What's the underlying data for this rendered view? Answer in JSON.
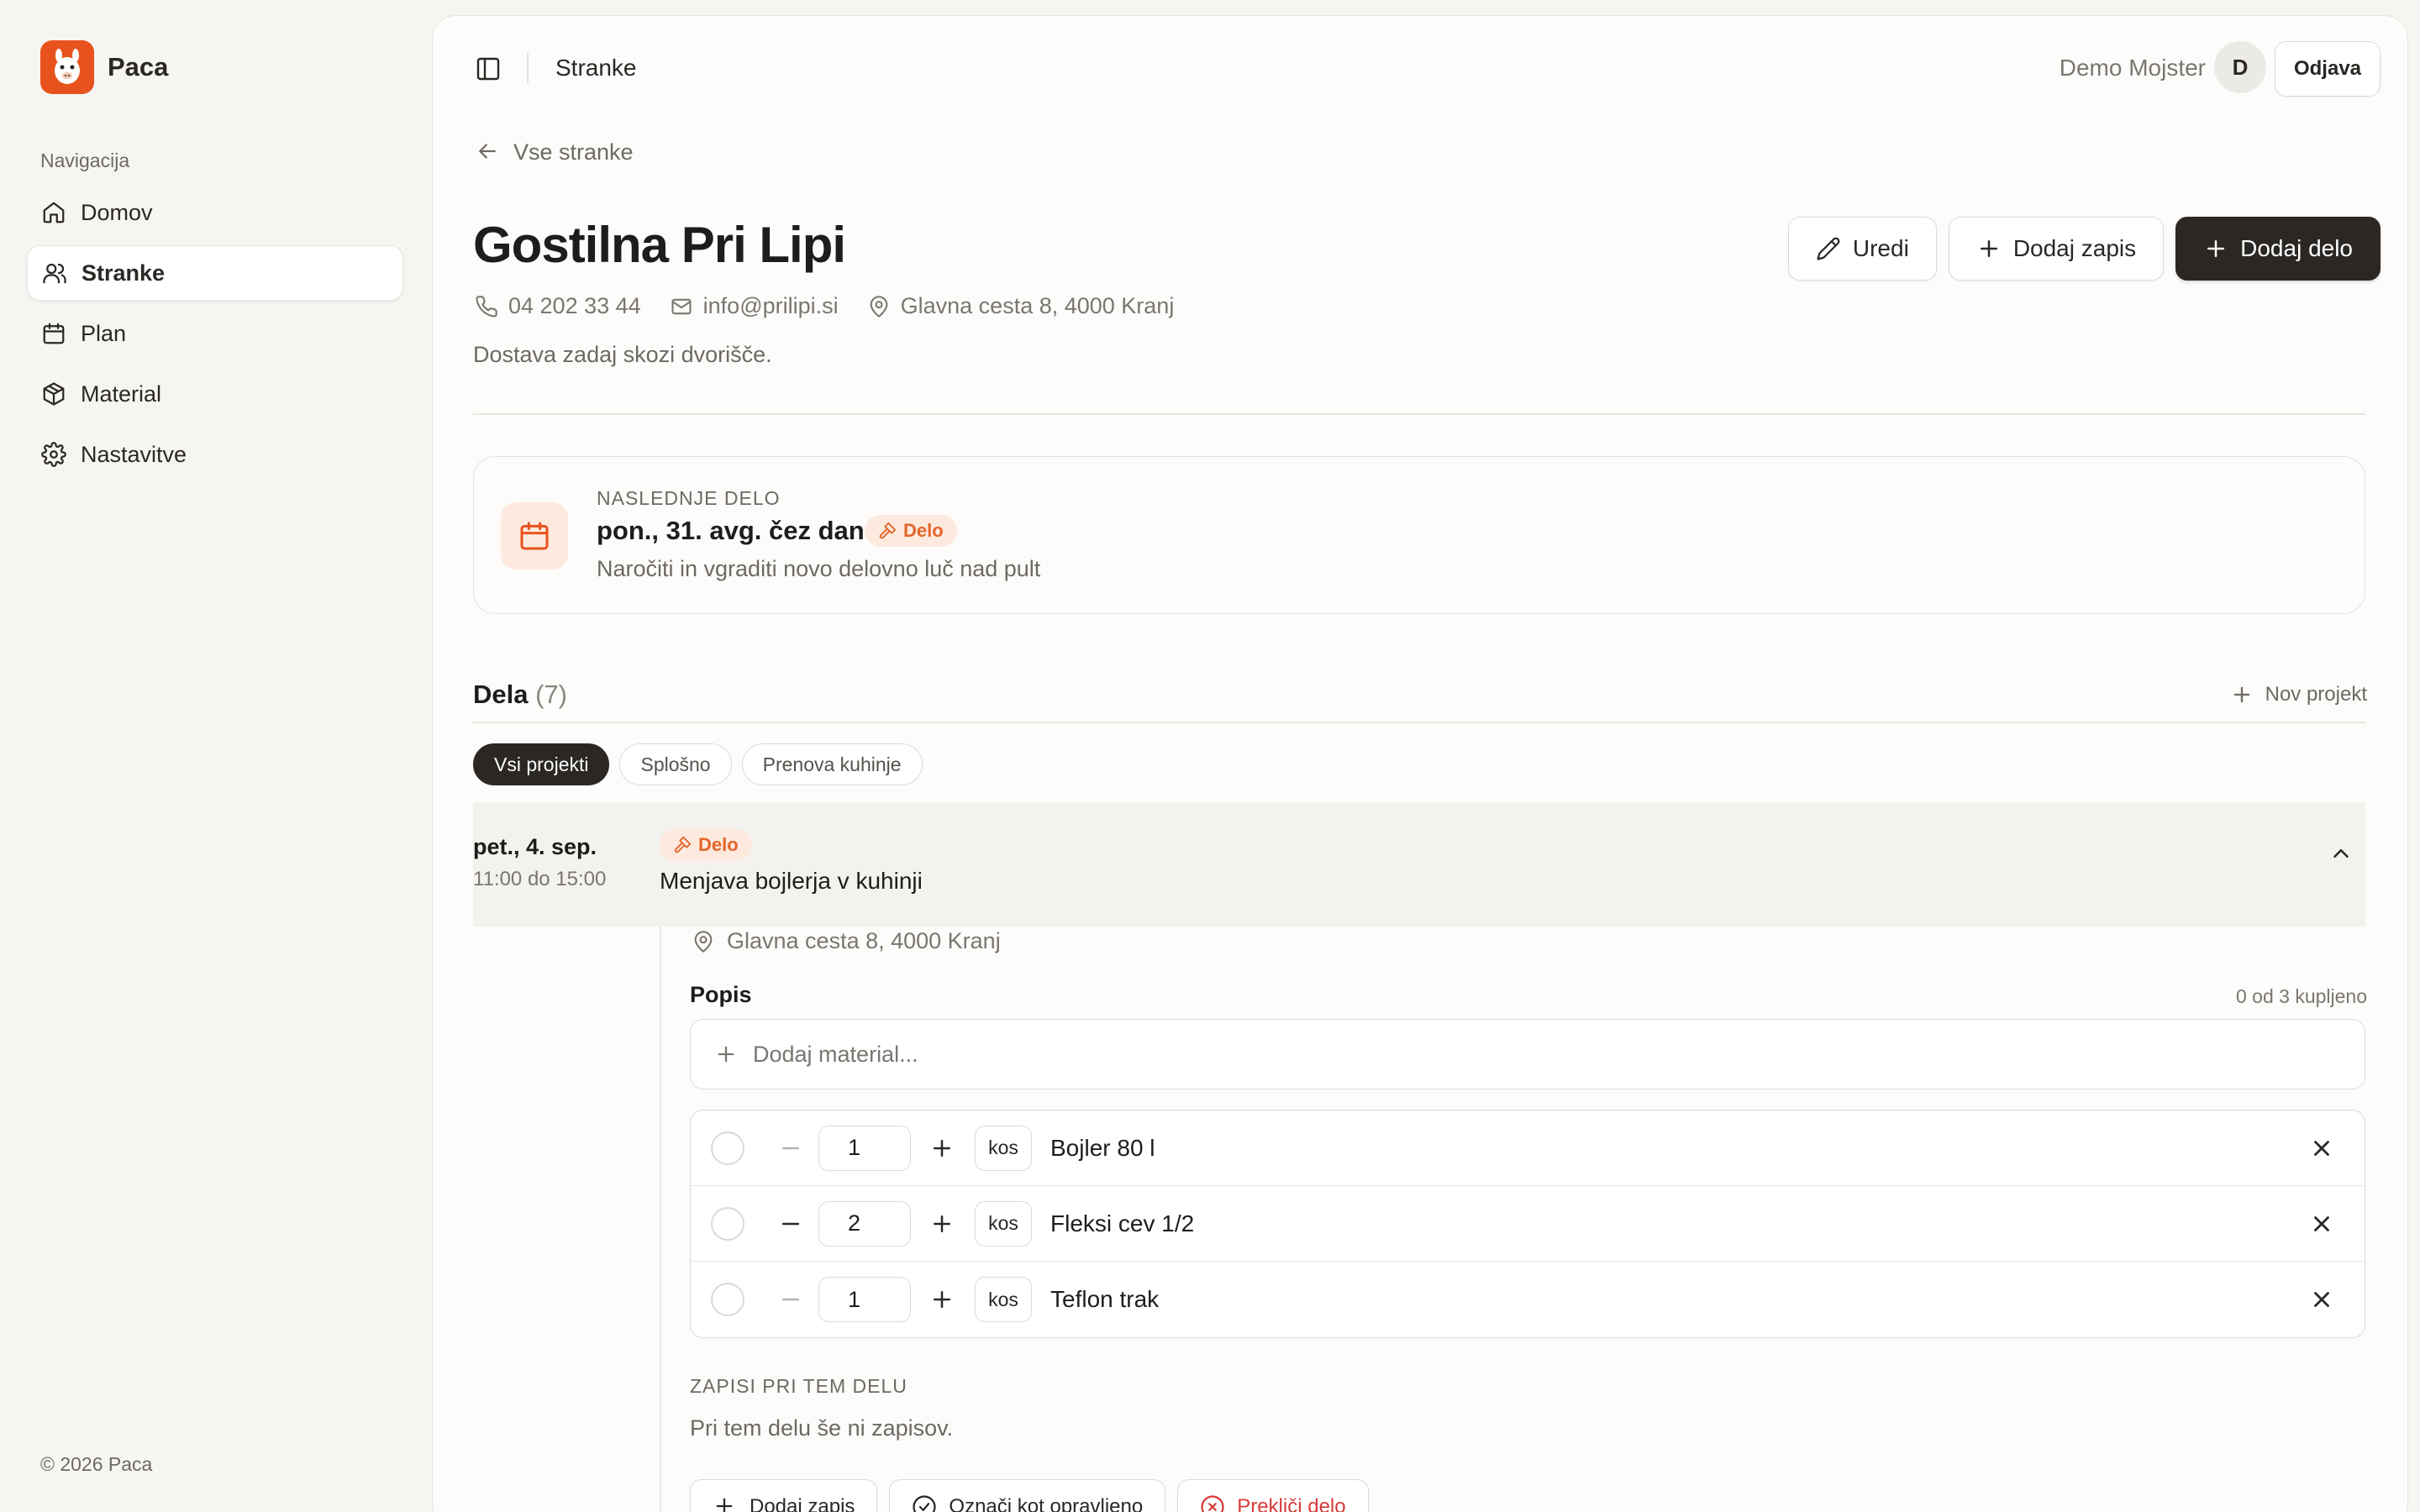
{
  "brand": {
    "name": "Paca"
  },
  "sidebar": {
    "heading": "Navigacija",
    "items": [
      {
        "label": "Domov",
        "icon": "home-icon"
      },
      {
        "label": "Stranke",
        "icon": "users-icon",
        "active": true
      },
      {
        "label": "Plan",
        "icon": "calendar-icon"
      },
      {
        "label": "Material",
        "icon": "package-icon"
      },
      {
        "label": "Nastavitve",
        "icon": "settings-icon"
      }
    ],
    "copyright": "© 2026 Paca"
  },
  "topbar": {
    "title": "Stranke",
    "user_name": "Demo Mojster",
    "avatar_initial": "D",
    "logout_label": "Odjava"
  },
  "back_link": "Vse stranke",
  "client": {
    "name": "Gostilna Pri Lipi",
    "phone": "04 202 33 44",
    "email": "info@prilipi.si",
    "address": "Glavna cesta 8, 4000 Kranj",
    "note": "Dostava zadaj skozi dvorišče."
  },
  "actions": {
    "edit": "Uredi",
    "add_note": "Dodaj zapis",
    "add_job": "Dodaj delo"
  },
  "next_job": {
    "label": "NASLEDNJE DELO",
    "date": "pon., 31. avg. čez dan",
    "badge": "Delo",
    "description": "Naročiti in vgraditi novo delovno luč nad pult"
  },
  "jobs": {
    "title": "Dela",
    "count": "(7)",
    "new_project": "Nov projekt",
    "filters": [
      "Vsi projekti",
      "Splošno",
      "Prenova kuhinje"
    ]
  },
  "job": {
    "date": "pet., 4. sep.",
    "time": "11:00 do 15:00",
    "badge": "Delo",
    "title": "Menjava bojlerja v kuhinji",
    "address": "Glavna cesta 8, 4000 Kranj",
    "popis_title": "Popis",
    "bought": "0 od 3 kupljeno",
    "add_material_placeholder": "Dodaj material...",
    "materials": [
      {
        "qty": "1",
        "unit": "kos",
        "name": "Bojler 80 l"
      },
      {
        "qty": "2",
        "unit": "kos",
        "name": "Fleksi cev 1/2"
      },
      {
        "qty": "1",
        "unit": "kos",
        "name": "Teflon trak"
      }
    ],
    "notes_label": "ZAPISI PRI TEM DELU",
    "notes_empty": "Pri tem delu še ni zapisov.",
    "buttons": {
      "add_note": "Dodaj zapis",
      "mark_done": "Označi kot opravljeno",
      "cancel": "Prekliči delo"
    }
  },
  "colors": {
    "accent": "#e8531d",
    "dark": "#2a2724",
    "danger": "#d83a3a"
  }
}
